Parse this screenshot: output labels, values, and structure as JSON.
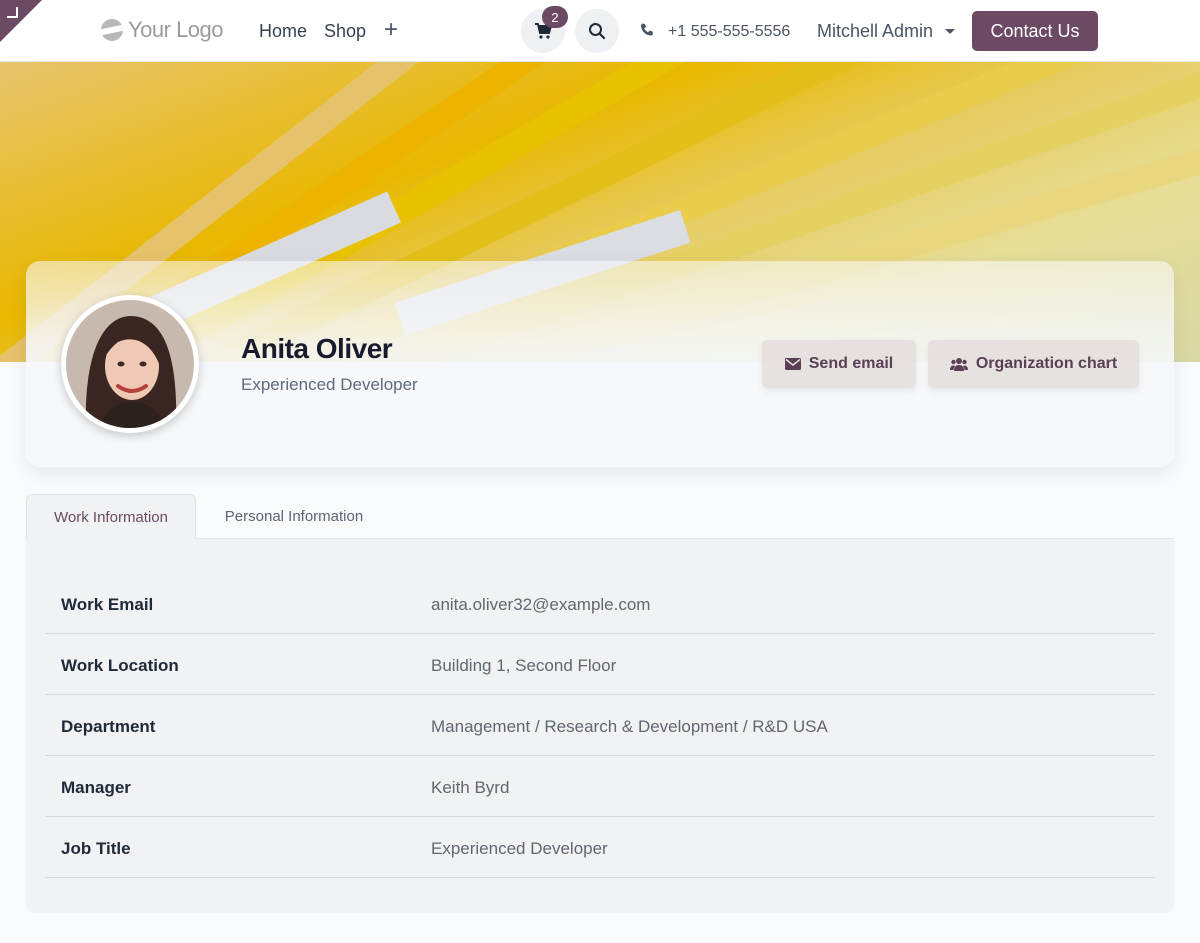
{
  "navbar": {
    "logo_text": "Your Logo",
    "links": [
      "Home",
      "Shop"
    ],
    "plus_label": "+",
    "cart_count": "2",
    "phone": "+1 555-555-5556",
    "user_name": "Mitchell Admin",
    "contact_label": "Contact Us",
    "accent_color": "#6c4a63"
  },
  "profile": {
    "name": "Anita Oliver",
    "job_title": "Experienced Developer",
    "send_email_label": "Send email",
    "org_chart_label": "Organization chart"
  },
  "tabs": [
    {
      "label": "Work Information",
      "active": true
    },
    {
      "label": "Personal Information",
      "active": false
    }
  ],
  "work_info": [
    {
      "label": "Work Email",
      "value": "anita.oliver32@example.com"
    },
    {
      "label": "Work Location",
      "value": "Building 1, Second Floor"
    },
    {
      "label": "Department",
      "value": "Management / Research & Development / R&D USA"
    },
    {
      "label": "Manager",
      "value": "Keith Byrd"
    },
    {
      "label": "Job Title",
      "value": "Experienced Developer"
    }
  ]
}
